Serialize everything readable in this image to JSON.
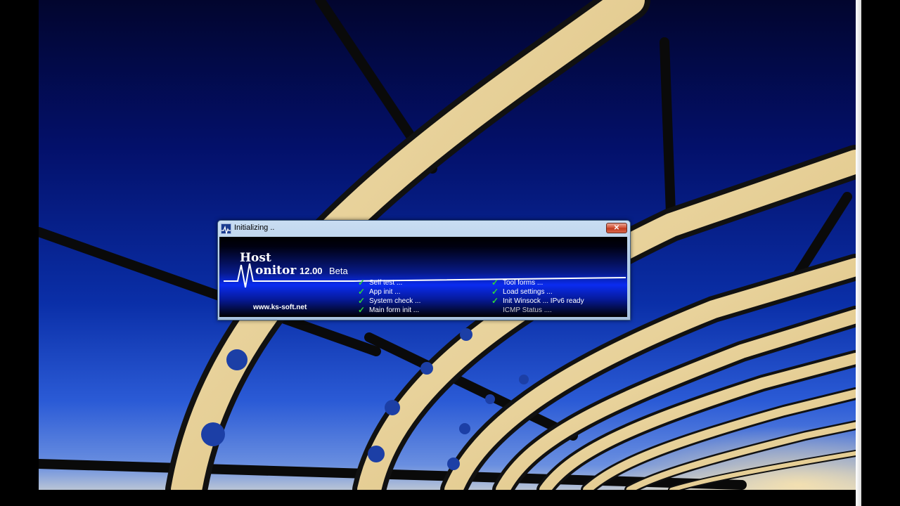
{
  "window": {
    "title": "Initializing ..",
    "close_label": "✕"
  },
  "splash": {
    "logo_host": "Host",
    "logo_onitor": "onitor",
    "version": "12.00",
    "edition": "Beta",
    "website": "www.ks-soft.net"
  },
  "status_left": [
    {
      "label": "Self test ...",
      "done": true
    },
    {
      "label": "App init ...",
      "done": true
    },
    {
      "label": "System check ...",
      "done": true
    },
    {
      "label": "Main form init ...",
      "done": true
    }
  ],
  "status_right": [
    {
      "label": "Tool forms ...",
      "done": true
    },
    {
      "label": "Load settings ...",
      "done": true
    },
    {
      "label": "Init Winsock ... IPv6 ready",
      "done": true
    },
    {
      "label": "ICMP Status ....",
      "done": false
    }
  ],
  "icons": {
    "check": "✓",
    "app_icon": "heartbeat-icon",
    "close_icon": "close-icon"
  },
  "colors": {
    "check_green": "#2fd23a",
    "splash_blue": "#0a2cf0",
    "close_red": "#c23a1e"
  }
}
